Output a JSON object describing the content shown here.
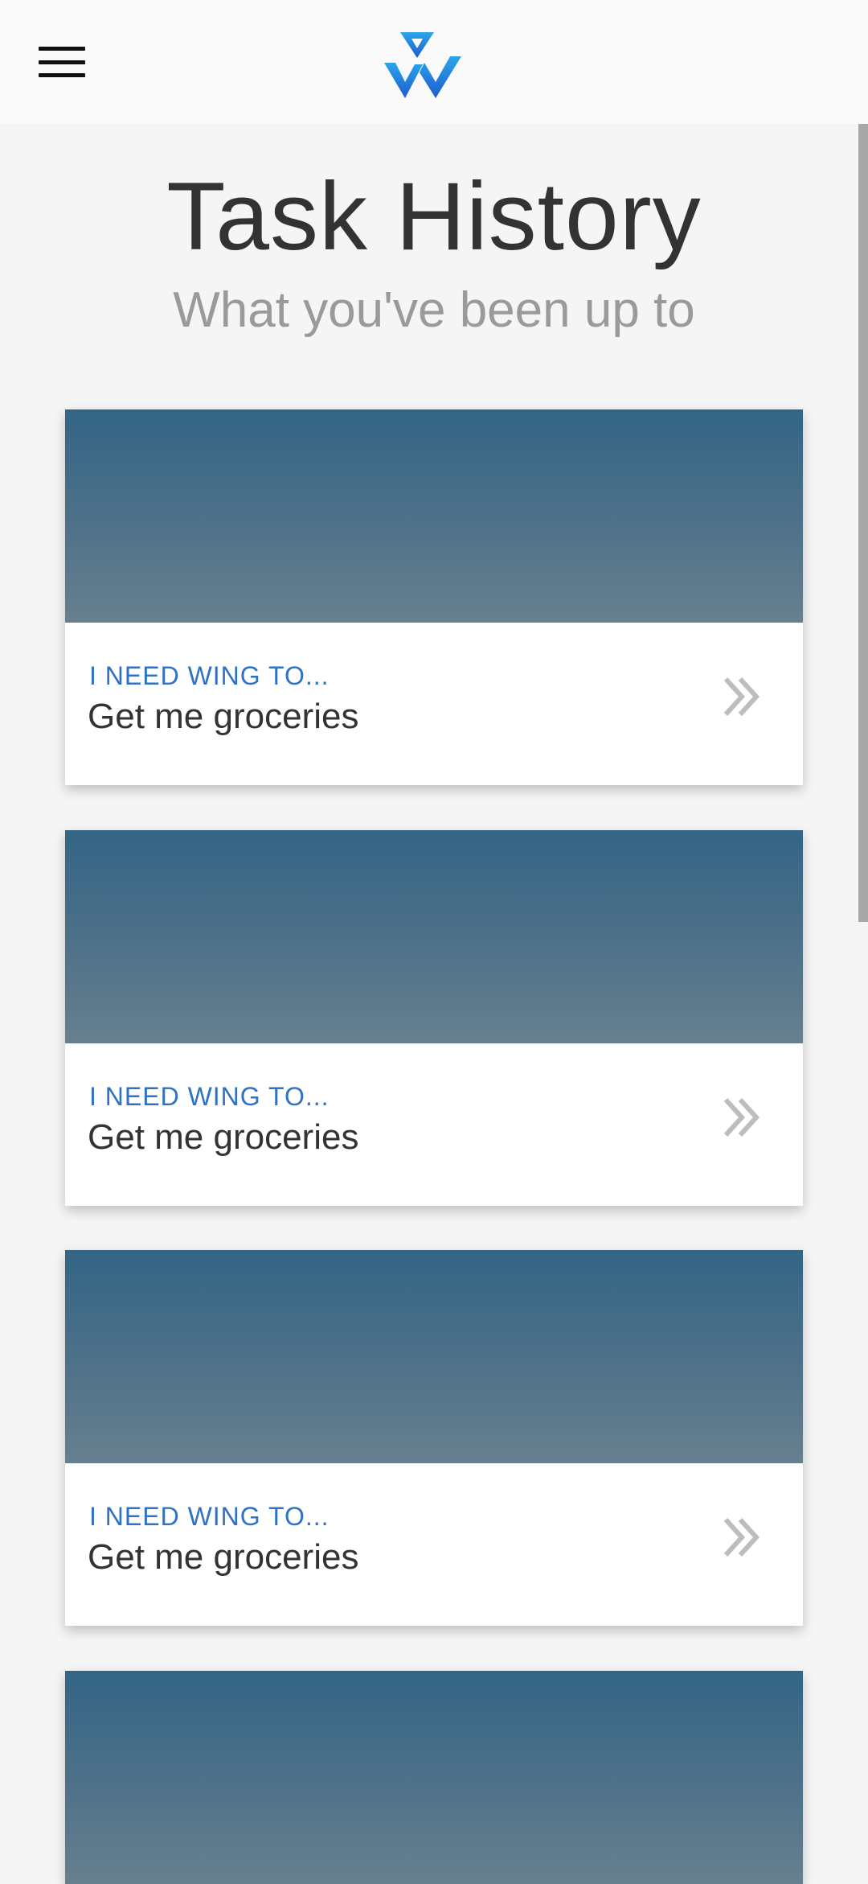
{
  "header": {
    "menu_icon": "hamburger-menu-icon",
    "logo_icon": "wing-logo-icon",
    "brand_colors": [
      "#2a9fe4",
      "#1f5fd1"
    ]
  },
  "page": {
    "title": "Task History",
    "subtitle": "What you've been up to"
  },
  "tasks": [
    {
      "label": "I NEED WING TO...",
      "title": "Get me groceries",
      "arrow_icon": "double-chevron-right-icon"
    },
    {
      "label": "I NEED WING TO...",
      "title": "Get me groceries",
      "arrow_icon": "double-chevron-right-icon"
    },
    {
      "label": "I NEED WING TO...",
      "title": "Get me groceries",
      "arrow_icon": "double-chevron-right-icon"
    },
    {
      "label": "",
      "title": "",
      "arrow_icon": ""
    }
  ],
  "colors": {
    "accent_label": "#2f72c4",
    "banner_top": "#336585",
    "banner_bottom": "#66808f",
    "background": "#f5f5f5"
  }
}
